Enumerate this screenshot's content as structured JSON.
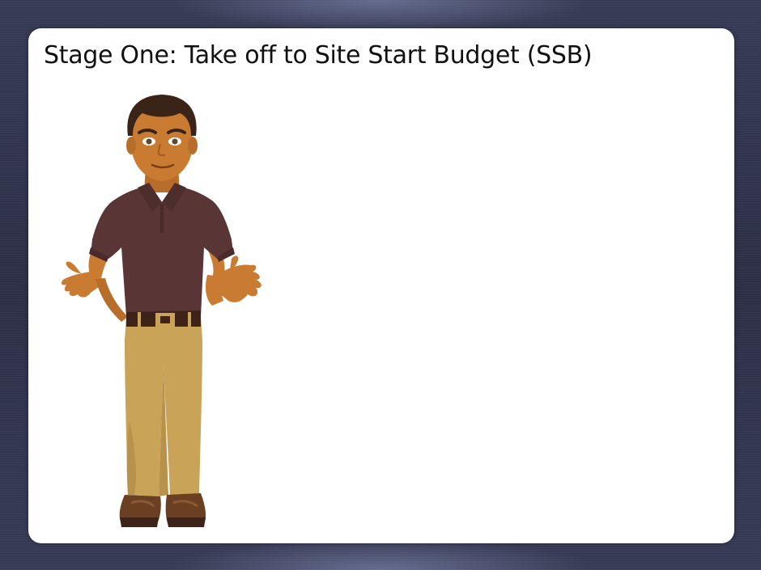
{
  "slide": {
    "title": "Stage One: Take off to Site Start Budget (SSB)"
  },
  "character": {
    "icon": "presenter-character-illustration"
  },
  "colors": {
    "frame_background": "#2f3249",
    "slide_background": "#ffffff",
    "shirt": "#5a3535",
    "trousers": "#c9a458",
    "skin": "#c97b32",
    "hair": "#3a2417",
    "shoes": "#6a3f22"
  }
}
